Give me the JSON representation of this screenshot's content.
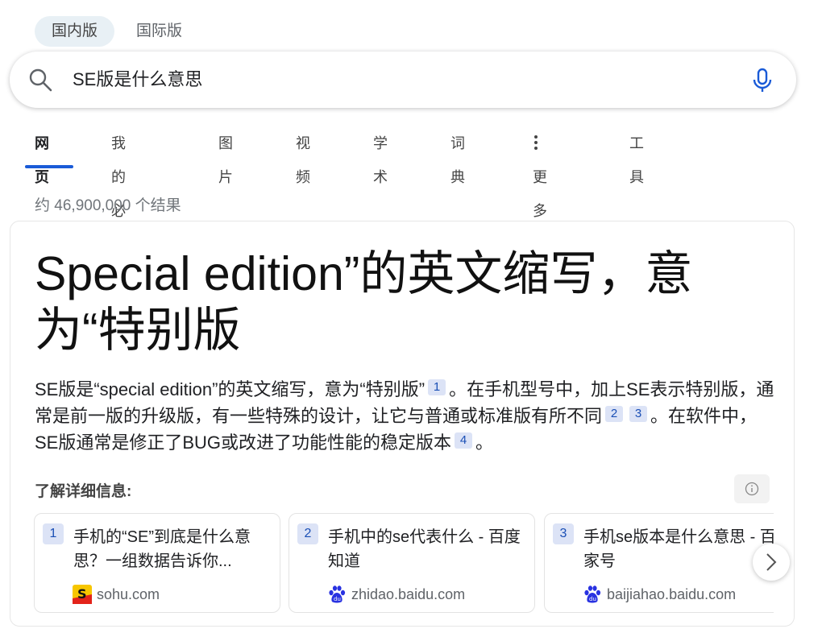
{
  "region_tabs": [
    {
      "label": "国内版",
      "active": true
    },
    {
      "label": "国际版",
      "active": false
    }
  ],
  "search": {
    "query": "SE版是什么意思",
    "icons": {
      "search": "search-icon",
      "mic": "microphone-icon"
    }
  },
  "nav": {
    "items": [
      {
        "label": "网页",
        "active": true
      },
      {
        "label": "我的必应"
      },
      {
        "label": "图片"
      },
      {
        "label": "视频"
      },
      {
        "label": "学术"
      },
      {
        "label": "词典"
      },
      {
        "label": "更多"
      },
      {
        "label": "工具"
      }
    ]
  },
  "results": {
    "count_text": "约 46,900,000 个结果"
  },
  "answer": {
    "title": "Special edition”的英文缩写，意为“特别版",
    "body_parts": [
      "SE版是“special edition”的英文缩写，意为“特别版”",
      "。在手机型号中，加上SE表示特别版，通常是前一版的升级版，有一些特殊的设计，让它与普通或标准版有所不同",
      "。在软件中，SE版通常是修正了BUG或改进了功能性能的稳定版本",
      "。"
    ],
    "citations": [
      "1",
      "2",
      "3",
      "4"
    ],
    "learn_more_label": "了解详细信息:"
  },
  "sources": [
    {
      "num": "1",
      "title": "手机的“SE”到底是什么意思？一组数据告诉你...",
      "domain": "sohu.com",
      "icon": "sohu-logo-icon"
    },
    {
      "num": "2",
      "title": "手机中的se代表什么 - 百度知道",
      "domain": "zhidao.baidu.com",
      "icon": "baidu-paw-icon"
    },
    {
      "num": "3",
      "title": "手机se版本是什么意思 - 百家号",
      "domain": "baijiahao.baidu.com",
      "icon": "baidu-paw-icon"
    }
  ],
  "colors": {
    "accent": "#1a5bd7",
    "citation_bg": "#dce3f6",
    "active_tab_bg": "#e8f0f5"
  }
}
